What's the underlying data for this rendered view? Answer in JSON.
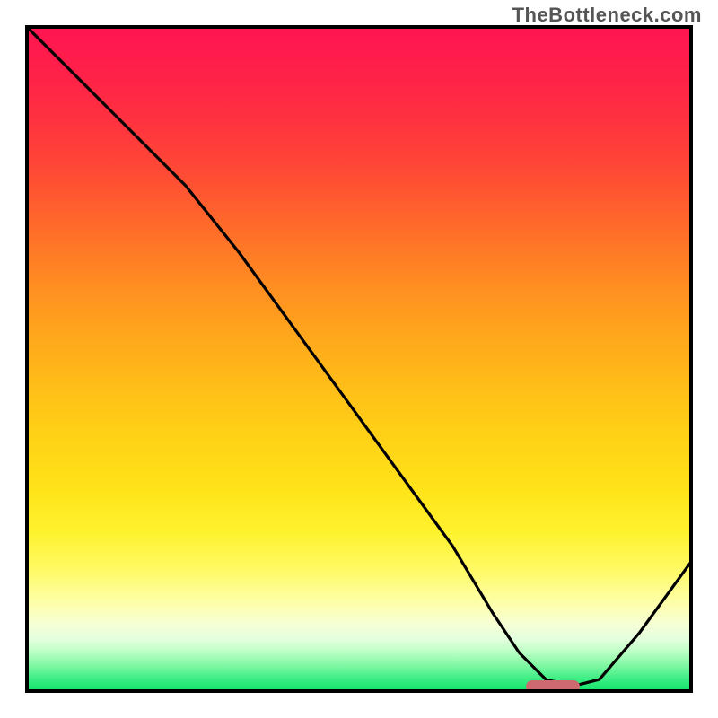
{
  "watermark": "TheBottleneck.com",
  "colors": {
    "curve": "#000000",
    "marker": "#cd6a6f",
    "border": "#000000",
    "gradient_top": "#ff1452",
    "gradient_bottom": "#0ce36a"
  },
  "chart_data": {
    "type": "line",
    "title": "",
    "xlabel": "",
    "ylabel": "",
    "xlim": [
      0,
      100
    ],
    "ylim": [
      0,
      100
    ],
    "grid": false,
    "legend": false,
    "annotations": [
      "TheBottleneck.com"
    ],
    "series": [
      {
        "name": "bottleneck-curve",
        "x": [
          0,
          8,
          16,
          24,
          32,
          40,
          48,
          56,
          64,
          70,
          74,
          78,
          82,
          86,
          92,
          100
        ],
        "values": [
          100,
          92,
          84,
          76,
          66,
          55,
          44,
          33,
          22,
          12,
          6,
          2,
          1,
          2,
          9,
          20
        ]
      }
    ],
    "markers": [
      {
        "name": "optimal-point",
        "x": 79,
        "y": 1,
        "width_pct": 8
      }
    ],
    "background": "vertical-gradient red→orange→yellow→green"
  }
}
